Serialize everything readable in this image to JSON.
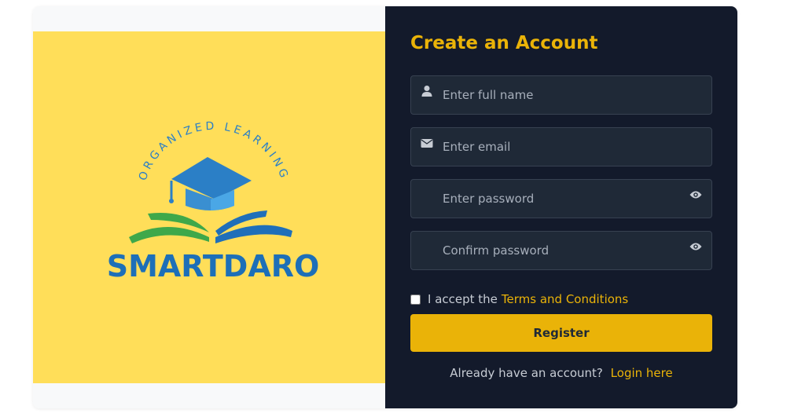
{
  "branding": {
    "logo_name": "SMARTDARO",
    "logo_tagline": "ORGANIZED LEARNING",
    "logo_colors": {
      "background": "#ffde59",
      "blue": "#2b7fc6",
      "cap": "#3a8fd1",
      "green": "#3ea84a",
      "text": "#1d6fb8"
    }
  },
  "form": {
    "title": "Create an Account",
    "full_name_placeholder": "Enter full name",
    "email_placeholder": "Enter email",
    "password_placeholder": "Enter password",
    "confirm_password_placeholder": "Confirm password",
    "terms_prefix": "I accept the",
    "terms_link": "Terms and Conditions",
    "terms_checked": false,
    "register_label": "Register",
    "login_prompt": "Already have an account?",
    "login_link": "Login here"
  },
  "icons": {
    "full_name": "user-icon",
    "email": "envelope-icon",
    "password_toggle": "eye-icon",
    "confirm_toggle": "eye-icon"
  },
  "theme": {
    "panel_bg": "#131a2b",
    "input_bg": "#1f2937",
    "accent": "#eab308"
  }
}
